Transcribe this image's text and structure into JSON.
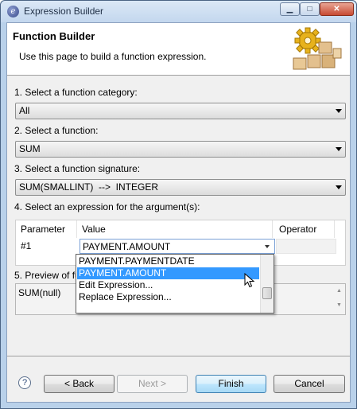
{
  "window": {
    "title": "Expression Builder",
    "minimize": "▁",
    "maximize": "□",
    "close": "✕"
  },
  "header": {
    "title": "Function Builder",
    "description": "Use this page to build a function expression."
  },
  "steps": {
    "category_label": "1. Select a function category:",
    "category_value": "All",
    "function_label": "2. Select a function:",
    "function_value": "SUM",
    "signature_label": "3. Select a function signature:",
    "signature_value": "SUM(SMALLINT)  -->  INTEGER",
    "argument_label": "4. Select an expression for the argument(s):"
  },
  "argument_table": {
    "columns": [
      "Parameter",
      "Value",
      "Operator"
    ],
    "rows": [
      {
        "parameter": "#1",
        "value": "PAYMENT.AMOUNT",
        "operator": ""
      }
    ]
  },
  "dropdown": {
    "items": [
      "PAYMENT.PAYMENTDATE",
      "PAYMENT.AMOUNT",
      "Edit Expression...",
      "Replace Expression..."
    ],
    "selected_index": 1
  },
  "preview": {
    "label": "5. Preview of fu",
    "value": "SUM(null)"
  },
  "footer": {
    "help": "?",
    "back": "< Back",
    "next": "Next >",
    "finish": "Finish",
    "cancel": "Cancel"
  },
  "colors": {
    "selection": "#3399ff",
    "window_frame": "#b9d1ea",
    "dialog_bg": "#f0f0f0"
  }
}
